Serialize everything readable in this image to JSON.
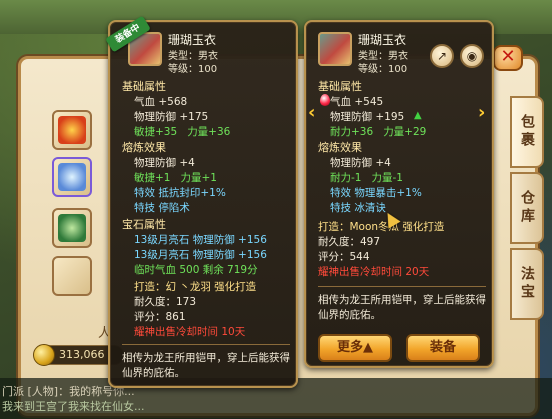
{
  "inventory": {
    "tabs": [
      {
        "label": "包裹"
      },
      {
        "label": "仓库"
      },
      {
        "label": "法宝"
      }
    ],
    "gold": "313,066",
    "count_label": "人"
  },
  "chat": {
    "line1": "门派 [人物]：我的称号你...",
    "line2": "我来到王宫了我来找在仙女..."
  },
  "left_card": {
    "badge": "装备中",
    "name": "珊瑚玉衣",
    "type": "类型：男衣",
    "level": "等级：100",
    "basic_header": "基础属性",
    "basic": [
      {
        "label": "气血",
        "value": "+568",
        "cls": "w"
      },
      {
        "label": "物理防御",
        "value": "+175",
        "cls": "w"
      },
      {
        "label": "敏捷+35",
        "value": "力量+36",
        "cls": "g"
      }
    ],
    "forge_header": "熔炼效果",
    "forge": [
      {
        "label": "物理防御",
        "value": "+4",
        "cls": "w"
      },
      {
        "label": "敏捷+1",
        "value": "力量+1",
        "cls": "g"
      },
      {
        "label": "特效",
        "value": "抵抗封印+1%",
        "cls": "c"
      },
      {
        "label": "特技",
        "value": "停陷术",
        "cls": "c"
      }
    ],
    "gem_header": "宝石属性",
    "gems": [
      {
        "label": "13级月亮石",
        "value": "物理防御 +156",
        "cls": "c"
      },
      {
        "label": "13级月亮石",
        "value": "物理防御 +156",
        "cls": "c"
      }
    ],
    "temp": "临时气血 500 剩余 719分",
    "forged": "打造：幻 丶龙羽   强化打造",
    "durability": "耐久度：173",
    "score": "评分：861",
    "warning": "耀神出售冷却时间 10天",
    "desc": "相传为龙王所用铠甲，穿上后能获得仙界的庇佑。"
  },
  "right_card": {
    "name": "珊瑚玉衣",
    "type": "类型：男衣",
    "level": "等级：100",
    "basic_header": "基础属性",
    "basic": [
      {
        "label": "气血",
        "value": "+545",
        "cls": "w"
      },
      {
        "label": "物理防御",
        "value": "+195",
        "cls": "w"
      },
      {
        "label": "耐力+36",
        "value": "力量+29",
        "cls": "g"
      }
    ],
    "forge_header": "熔炼效果",
    "forge": [
      {
        "label": "物理防御",
        "value": "+4",
        "cls": "w"
      },
      {
        "label": "耐力-1",
        "value": "力量-1",
        "cls": "g"
      },
      {
        "label": "特效",
        "value": "物理暴击+1%",
        "cls": "c"
      },
      {
        "label": "特技",
        "value": "冰清诀",
        "cls": "c"
      }
    ],
    "forged": "打造：Moon冬瓜   强化打造",
    "durability": "耐久度：497",
    "score": "评分：544",
    "warning": "耀神出售冷却时间 20天",
    "desc": "相传为龙王所用铠甲，穿上后能获得仙界的庇佑。",
    "more_label": "更多▲",
    "equip_label": "装备"
  },
  "icons": {
    "share": "share-icon",
    "view": "eye-icon",
    "close": "close-icon"
  },
  "colors": {
    "card_border": "#b8924e",
    "green_stat": "#6fe35a",
    "cyan_stat": "#7ad7ff",
    "warning": "#ff4a3a",
    "button": "#f2a52a"
  }
}
